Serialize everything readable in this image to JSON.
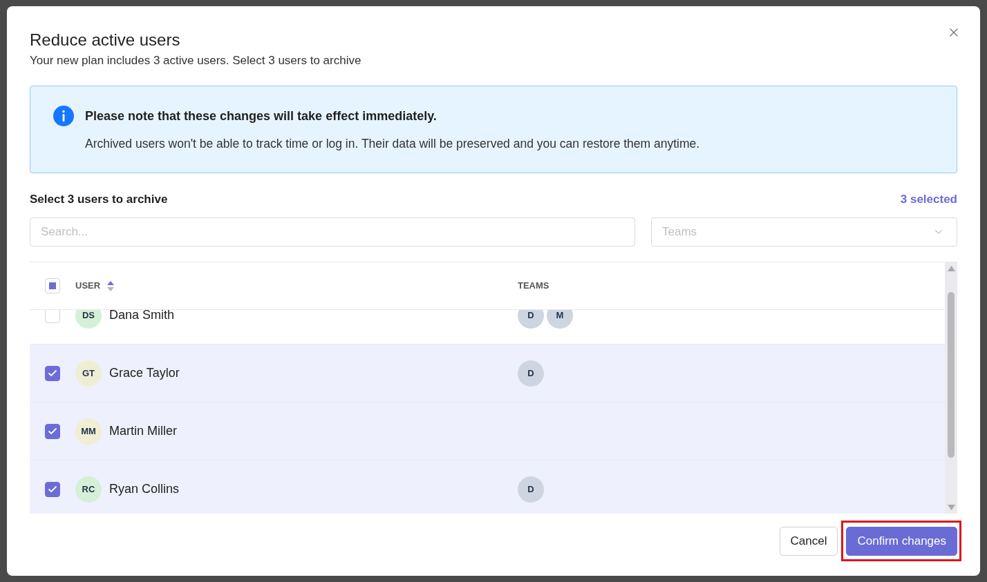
{
  "dialog": {
    "title": "Reduce active users",
    "subtitle": "Your new plan includes 3 active users. Select 3 users to archive"
  },
  "notice": {
    "title": "Please note that these changes will take effect immediately.",
    "text": "Archived users won't be able to track time or log in. Their data will be preserved and you can restore them anytime."
  },
  "selection": {
    "heading": "Select 3 users to archive",
    "count": "3 selected"
  },
  "search": {
    "placeholder": "Search..."
  },
  "teams_filter": {
    "placeholder": "Teams"
  },
  "table": {
    "select_all": {
      "indeterminate": true
    },
    "columns": [
      {
        "label": "USER",
        "sorted": true
      },
      {
        "label": "TEAMS",
        "sorted": false
      }
    ],
    "rows": [
      {
        "initials": "DS",
        "name": "Dana Smith",
        "color": "#d5f0d8",
        "teams": [
          "D",
          "M"
        ],
        "checked": false
      },
      {
        "initials": "GT",
        "name": "Grace Taylor",
        "color": "#efeed5",
        "teams": [
          "D"
        ],
        "checked": true
      },
      {
        "initials": "MM",
        "name": "Martin Miller",
        "color": "#f0eed3",
        "teams": [],
        "checked": true
      },
      {
        "initials": "RC",
        "name": "Ryan Collins",
        "color": "#d5f0d8",
        "teams": [
          "D"
        ],
        "checked": true
      }
    ]
  },
  "buttons": [
    {
      "label": "Cancel",
      "kind": "secondary",
      "highlighted": false
    },
    {
      "label": "Confirm changes",
      "kind": "primary",
      "highlighted": true
    }
  ]
}
